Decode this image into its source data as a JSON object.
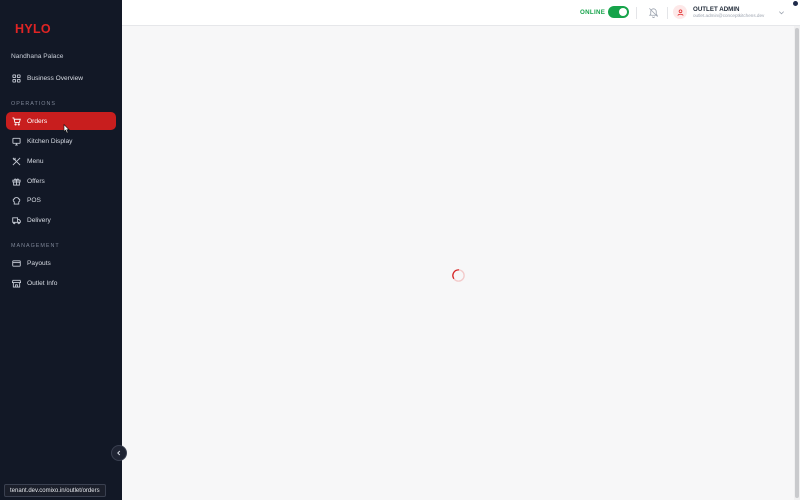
{
  "sidebar": {
    "logo": "HYLO",
    "outlet_name": "Nandhana Palace",
    "top_items": [
      {
        "label": "Business Overview",
        "icon": "grid-icon"
      }
    ],
    "sections": [
      {
        "title": "OPERATIONS",
        "items": [
          {
            "label": "Orders",
            "icon": "cart-icon",
            "active": true
          },
          {
            "label": "Kitchen Display",
            "icon": "monitor-icon"
          },
          {
            "label": "Menu",
            "icon": "utensils-icon"
          },
          {
            "label": "Offers",
            "icon": "gift-icon"
          },
          {
            "label": "POS",
            "icon": "chef-hat-icon"
          },
          {
            "label": "Delivery",
            "icon": "truck-icon"
          }
        ]
      },
      {
        "title": "MANAGEMENT",
        "items": [
          {
            "label": "Payouts",
            "icon": "card-icon"
          },
          {
            "label": "Outlet Info",
            "icon": "store-icon"
          }
        ]
      }
    ],
    "status_url": "tenant.dev.comixo.in/outlet/orders"
  },
  "header": {
    "status_label": "ONLINE",
    "online": true,
    "user_role": "OUTLET ADMIN",
    "user_email": "outlet.admin@conceptkitchens.dev"
  },
  "main": {
    "state": "loading"
  },
  "colors": {
    "accent": "#c81e1e",
    "sidebar_bg": "#121826",
    "online_green": "#16a34a"
  }
}
